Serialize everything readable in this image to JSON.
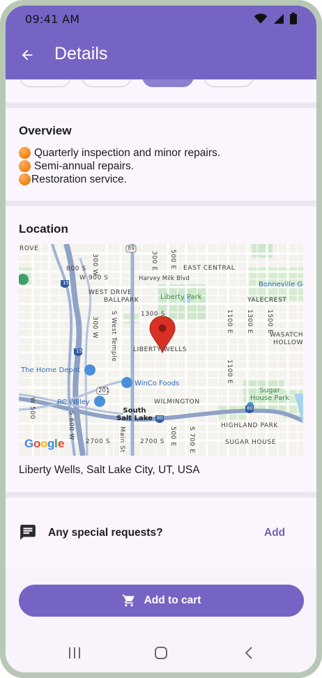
{
  "status_bar": {
    "time": "09:41 AM",
    "icons": [
      "wifi-icon",
      "cellular-signal-icon",
      "battery-icon"
    ]
  },
  "app_bar": {
    "title": "Details",
    "back_icon": "arrow-back-icon"
  },
  "overview": {
    "title": "Overview",
    "bullet_icon": "orange-circle-emoji",
    "items": [
      "Quarterly inspection and minor repairs.",
      "Semi-annual repairs.",
      "Restoration service."
    ]
  },
  "location": {
    "title": "Location",
    "address": "Liberty Wells, Salt Lake City, UT, USA",
    "map": {
      "pin_icon": "map-pin-icon",
      "provider": "Google",
      "labels": {
        "rove": "ROVE",
        "s_89_top": "89",
        "e_300": "300 E",
        "e_500": "500 E",
        "s_800": "800 S",
        "w_300": "300 W",
        "w_900_s": "W 900 S",
        "harvey_milk": "Harvey Milk Blvd",
        "east_central": "EAST CENTRAL",
        "bonneville": "Bonneville Golf",
        "west_drive": "WEST DRIVE",
        "ballpark": "BALLPARK",
        "liberty_park": "Liberty Park",
        "yalecrest": "YALECREST",
        "s_1300": "1300 S",
        "w_300_b": "300 W",
        "s_west_temple": "S West Temple",
        "e_1100": "1100 E",
        "e_1300": "1300 E",
        "e_1500": "1500 E",
        "wasatch_hollow": "WASATCH\nHOLLOW",
        "liberty_wells": "LIBERTY WELLS",
        "home_depot": "The Home Depot",
        "winco": "WinCo Foods",
        "s_201": "201",
        "e_1100_b": "1100 E",
        "sugar_house_park": "Sugar\nHouse Park",
        "rc_willey": "RC Willey",
        "wilmington": "WILMINGTON",
        "south_salt_lake": "South\nSalt Lake",
        "i80_a": "80",
        "i80_b": "80",
        "highland_park": "HIGHLAND PARK",
        "w_600_s": "S 600 W",
        "main_st": "Main St",
        "e_500_b": "500 E",
        "e_700_s": "S 700 E",
        "s_2700_a": "2700 S",
        "s_2700_b": "2700 S",
        "sugar_house": "SUGAR HOUSE",
        "i15_a": "15",
        "i15_b": "15",
        "w_500": "W 500"
      }
    }
  },
  "requests": {
    "label": "Any special requests?",
    "action": "Add",
    "icon": "chat-message-icon"
  },
  "cart_button": {
    "label": "Add to cart",
    "icon": "shopping-cart-icon"
  },
  "nav": {
    "recents_icon": "recent-apps-icon",
    "home_icon": "home-icon",
    "back_icon": "nav-back-icon"
  },
  "colors": {
    "primary": "#7564c3",
    "surface": "#fbf6fd",
    "accent_text": "#6f5fb8"
  }
}
